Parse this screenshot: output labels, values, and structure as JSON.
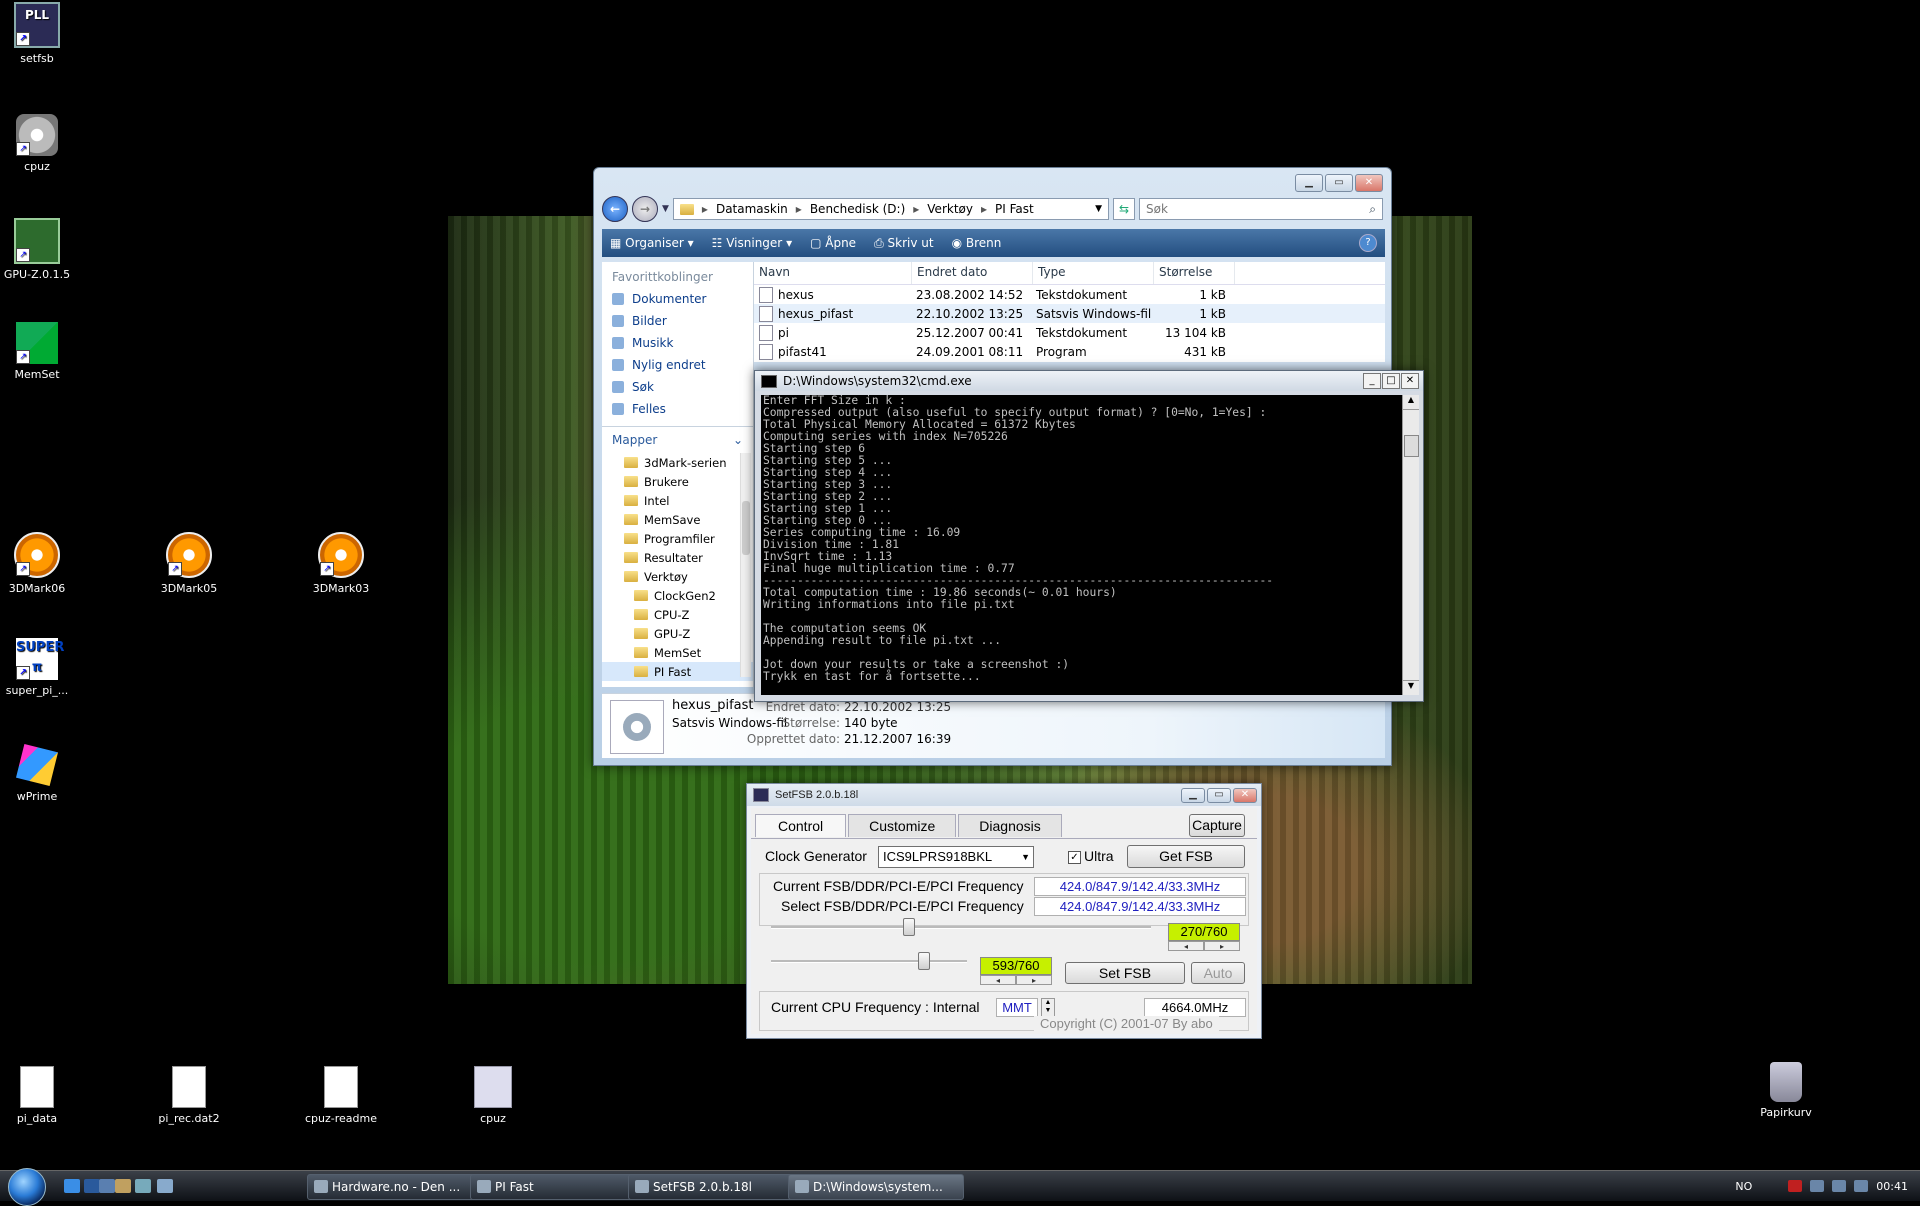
{
  "desktop": {
    "icons": [
      {
        "label": "setfsb",
        "icon": "pll-icon"
      },
      {
        "label": "cpuz",
        "icon": "cd-icon"
      },
      {
        "label": "GPU-Z.0.1.5",
        "icon": "gpu-chip-icon"
      },
      {
        "label": "MemSet",
        "icon": "ram-icon"
      },
      {
        "label": "3DMark06",
        "icon": "3dmark-icon"
      },
      {
        "label": "3DMark05",
        "icon": "3dmark-icon"
      },
      {
        "label": "3DMark03",
        "icon": "3dmark-icon"
      },
      {
        "label": "super_pi_...",
        "icon": "superpi-icon"
      },
      {
        "label": "wPrime",
        "icon": "wprime-icon"
      },
      {
        "label": "pi_data",
        "icon": "document-icon"
      },
      {
        "label": "pi_rec.dat2",
        "icon": "document-icon"
      },
      {
        "label": "cpuz-readme",
        "icon": "document-icon"
      },
      {
        "label": "cpuz",
        "icon": "gear-file-icon"
      },
      {
        "label": "Papirkurv",
        "icon": "recycle-bin-icon"
      }
    ]
  },
  "explorer": {
    "breadcrumb": [
      "Datamaskin",
      "Benchedisk (D:)",
      "Verktøy",
      "PI Fast"
    ],
    "search_placeholder": "Søk",
    "toolbar": [
      "Organiser",
      "Visninger",
      "Åpne",
      "Skriv ut",
      "Brenn"
    ],
    "favorites_header": "Favorittkoblinger",
    "favorites": [
      "Dokumenter",
      "Bilder",
      "Musikk",
      "Nylig endret",
      "Søk",
      "Felles"
    ],
    "folders_header": "Mapper",
    "folders": [
      "3dMark-serien",
      "Brukere",
      "Intel",
      "MemSave",
      "Programfiler",
      "Resultater",
      "Verktøy",
      "ClockGen2",
      "CPU-Z",
      "GPU-Z",
      "MemSet",
      "PI Fast"
    ],
    "columns": [
      "Navn",
      "Endret dato",
      "Type",
      "Størrelse"
    ],
    "files": [
      {
        "name": "hexus",
        "date": "23.08.2002 14:52",
        "type": "Tekstdokument",
        "size": "1 kB"
      },
      {
        "name": "hexus_pifast",
        "date": "22.10.2002 13:25",
        "type": "Satsvis Windows-fil",
        "size": "1 kB"
      },
      {
        "name": "pi",
        "date": "25.12.2007 00:41",
        "type": "Tekstdokument",
        "size": "13 104 kB"
      },
      {
        "name": "pifast41",
        "date": "24.09.2001 08:11",
        "type": "Program",
        "size": "431 kB"
      }
    ],
    "details": {
      "name": "hexus_pifast",
      "type": "Satsvis Windows-fil",
      "modified_label": "Endret dato:",
      "modified_value": "22.10.2002 13:25",
      "size_label": "Størrelse:",
      "size_value": "140 byte",
      "created_label": "Opprettet dato:",
      "created_value": "21.12.2007 16:39"
    }
  },
  "cmd": {
    "title": "D:\\Windows\\system32\\cmd.exe",
    "lines": [
      "Enter FFT Size in k :",
      "Compressed output (also useful to specify output format) ? [0=No, 1=Yes] :",
      "Total Physical Memory Allocated = 61372 Kbytes",
      "Computing series with index N=705226",
      "Starting step 6",
      "Starting step 5 ...",
      "Starting step 4 ...",
      "Starting step 3 ...",
      "Starting step 2 ...",
      "Starting step 1 ...",
      "Starting step 0 ...",
      "Series computing time : 16.09",
      "Division time : 1.81",
      "InvSqrt time : 1.13",
      "Final huge multiplication time : 0.77",
      "---------------------------------------------------------------------------",
      "Total computation time : 19.86 seconds(~ 0.01 hours)",
      "Writing informations into file pi.txt",
      "",
      "The computation seems OK",
      "Appending result to file pi.txt ...",
      "",
      "Jot down your results or take a screenshot :)",
      "Trykk en tast for å fortsette..."
    ]
  },
  "setfsb": {
    "title": "SetFSB 2.0.b.18l",
    "tabs": [
      "Control",
      "Customize",
      "Diagnosis"
    ],
    "capture": "Capture",
    "clock_gen_label": "Clock Generator",
    "clock_gen_value": "ICS9LPRS918BKL",
    "ultra_label": "Ultra",
    "ultra_checked": true,
    "get_fsb": "Get FSB",
    "current_label": "Current FSB/DDR/PCI-E/PCI Frequency",
    "current_value": "424.0/847.9/142.4/33.3MHz",
    "select_label": "Select FSB/DDR/PCI-E/PCI Frequency",
    "select_value": "424.0/847.9/142.4/33.3MHz",
    "slider1_value": "270/760",
    "slider2_value": "593/760",
    "set_fsb": "Set FSB",
    "auto": "Auto",
    "cpu_label": "Current CPU Frequency : Internal",
    "cpu_mode": "MMT",
    "cpu_value": "4664.0MHz",
    "copyright": "Copyright (C) 2001-07 By abo",
    "colors": {
      "highlight": "#c6f000",
      "value_text": "#2020c0"
    }
  },
  "taskbar": {
    "tasks": [
      "Hardware.no - Den ...",
      "PI Fast",
      "SetFSB 2.0.b.18l",
      "D:\\Windows\\system..."
    ],
    "language": "NO",
    "clock": "00:41"
  }
}
